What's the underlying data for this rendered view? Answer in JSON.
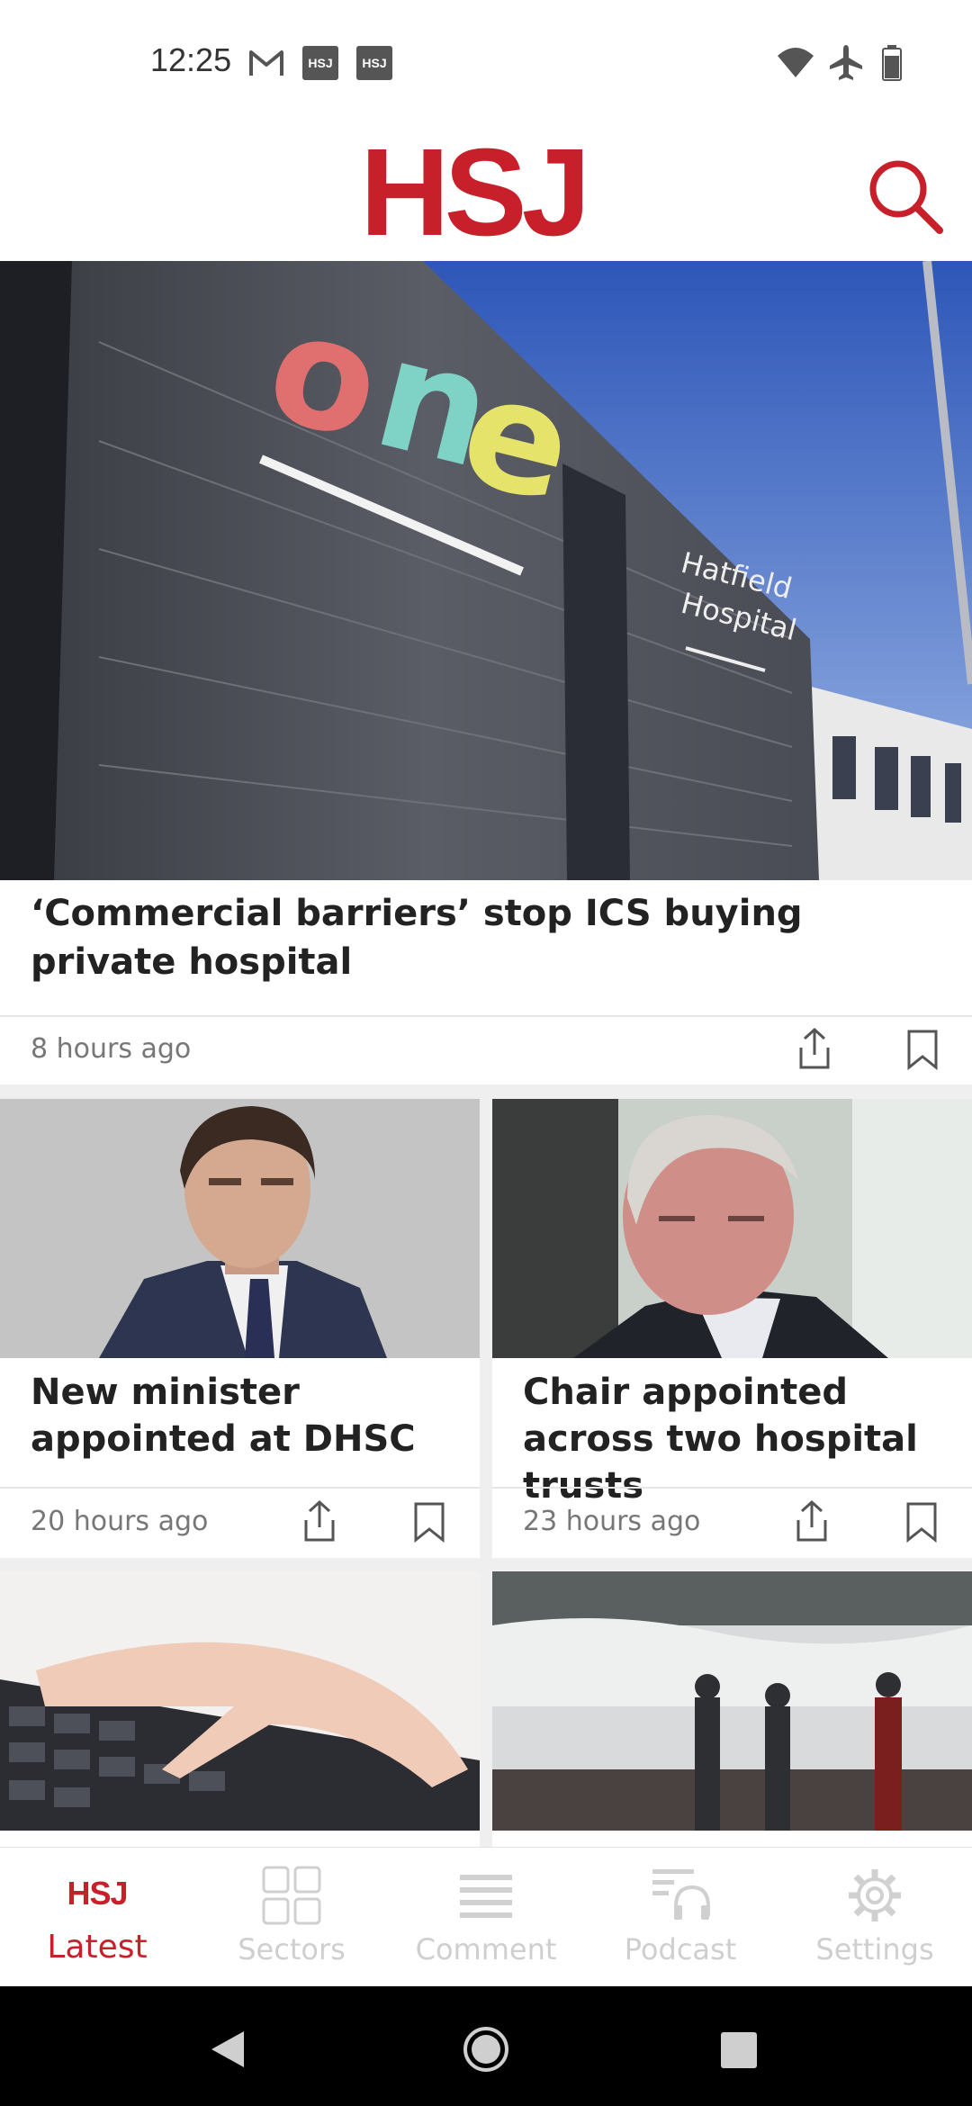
{
  "status_bar": {
    "time": "12:25",
    "notification_icons": [
      "gmail-icon",
      "hsj-app-icon",
      "hsj-app-icon"
    ],
    "app_badge_text": "HSJ",
    "right_icons": [
      "wifi-icon",
      "airplane-icon",
      "battery-icon"
    ]
  },
  "header": {
    "logo": "HSJ",
    "brand_color": "#c8202a"
  },
  "hero": {
    "title": "‘Commercial barriers’ stop ICS buying private hospital",
    "time": "8 hours ago",
    "image_texts": [
      "one",
      "Hatfield Hospital"
    ]
  },
  "grid": [
    {
      "title": "New minister appointed at DHSC",
      "time": "20 hours ago"
    },
    {
      "title": "Chair appointed across two hospital trusts",
      "time": "23 hours ago"
    }
  ],
  "bottom_nav": {
    "logo_icon_text": "HSJ",
    "items": [
      {
        "label": "Latest",
        "icon": "hsj-logo-icon",
        "active": true
      },
      {
        "label": "Sectors",
        "icon": "grid-icon",
        "active": false
      },
      {
        "label": "Comment",
        "icon": "lines-icon",
        "active": false
      },
      {
        "label": "Podcast",
        "icon": "headphones-icon",
        "active": false
      },
      {
        "label": "Settings",
        "icon": "gear-icon",
        "active": false
      }
    ]
  },
  "colors": {
    "accent": "#c8202a",
    "inactive_nav": "#cfcfcf",
    "meta_text": "#777777"
  }
}
